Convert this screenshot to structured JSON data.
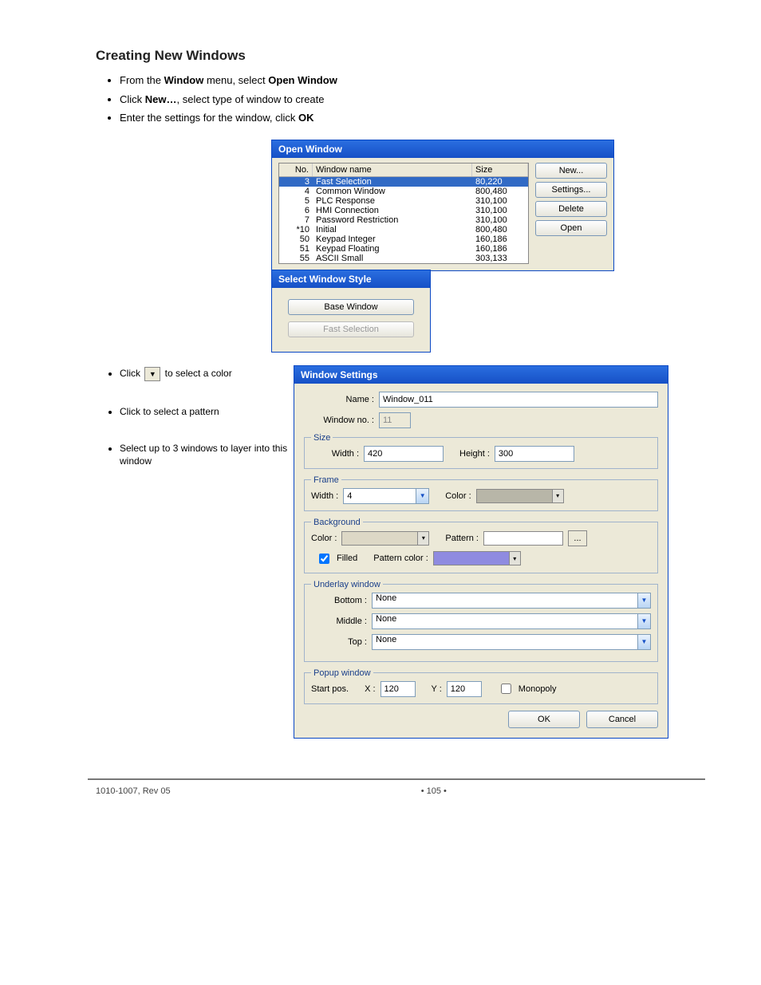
{
  "doc": {
    "section_title": "Creating New Windows",
    "intro_bullets": [
      {
        "text_before": "From the ",
        "bold": "Window",
        "text_after": " menu, select ",
        "bold2": "Open Window"
      },
      {
        "text_before": "Click ",
        "bold": "New…",
        "text_after": ", select type of window to create"
      },
      {
        "text_before": "Enter the settings for the window, click ",
        "bold": "OK",
        "text_after": ""
      }
    ],
    "left_notes": [
      {
        "pre": "Click ",
        "code_like": "dropdown",
        "post": " to select a color"
      },
      {
        "pre": "Click to select a pattern",
        "code_like": "",
        "post": ""
      },
      {
        "pre": "Select up to 3 windows to layer into this window",
        "code_like": "",
        "post": ""
      }
    ]
  },
  "open_window": {
    "title": "Open Window",
    "headers": {
      "no": "No.",
      "name": "Window name",
      "size": "Size"
    },
    "rows": [
      {
        "no": "3",
        "name": "Fast Selection",
        "size": "80,220",
        "selected": true
      },
      {
        "no": "4",
        "name": "Common Window",
        "size": "800,480"
      },
      {
        "no": "5",
        "name": "PLC Response",
        "size": "310,100"
      },
      {
        "no": "6",
        "name": "HMI Connection",
        "size": "310,100"
      },
      {
        "no": "7",
        "name": "Password Restriction",
        "size": "310,100"
      },
      {
        "no": "*10",
        "name": "Initial",
        "size": "800,480"
      },
      {
        "no": "50",
        "name": "Keypad Integer",
        "size": "160,186"
      },
      {
        "no": "51",
        "name": "Keypad Floating",
        "size": "160,186"
      },
      {
        "no": "55",
        "name": "ASCII Small",
        "size": "303,133"
      }
    ],
    "buttons": {
      "new": "New...",
      "settings": "Settings...",
      "delete": "Delete",
      "open": "Open"
    }
  },
  "select_style": {
    "title": "Select Window Style",
    "base": "Base Window",
    "fast": "Fast Selection"
  },
  "window_settings": {
    "title": "Window Settings",
    "labels": {
      "name": "Name :",
      "window_no": "Window no. :",
      "size_group": "Size",
      "width": "Width :",
      "height": "Height :",
      "frame_group": "Frame",
      "f_width": "Width :",
      "f_color": "Color :",
      "bg_group": "Background",
      "bg_color": "Color :",
      "bg_pattern": "Pattern :",
      "filled": "Filled",
      "pattern_color": "Pattern color :",
      "underlay_group": "Underlay window",
      "bottom": "Bottom :",
      "middle": "Middle :",
      "top": "Top :",
      "popup_group": "Popup window",
      "start_pos": "Start pos.",
      "x": "X :",
      "y": "Y :",
      "monopoly": "Monopoly"
    },
    "values": {
      "name": "Window_011",
      "window_no": "11",
      "width": "420",
      "height": "300",
      "frame_width": "4",
      "bottom": "None",
      "middle": "None",
      "top": "None",
      "x": "120",
      "y": "120",
      "filled_checked": true,
      "monopoly_checked": false
    },
    "buttons": {
      "ok": "OK",
      "cancel": "Cancel"
    }
  },
  "footer": {
    "left": "1010-1007, Rev 05",
    "mid": "• 105 •",
    "right": ""
  }
}
